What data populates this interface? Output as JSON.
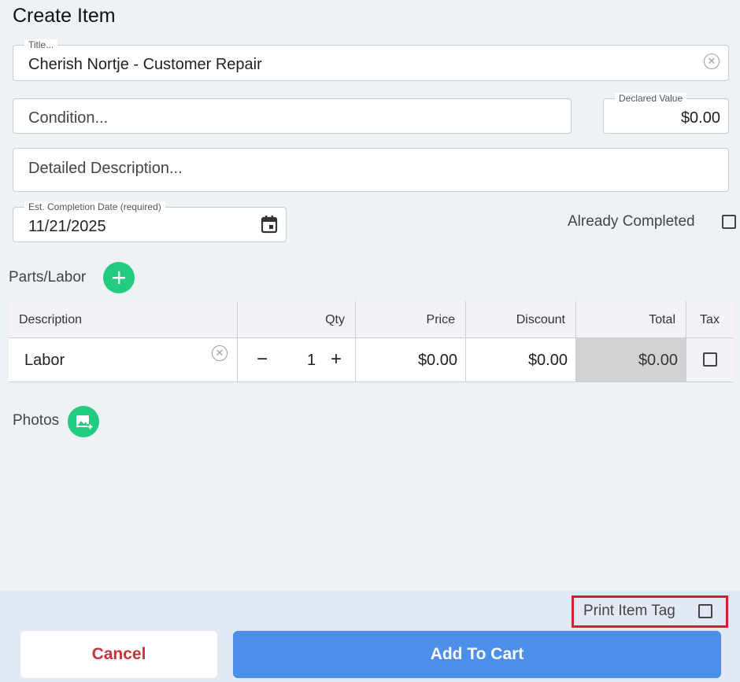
{
  "page": {
    "title": "Create Item"
  },
  "title_field": {
    "label": "Title...",
    "value": "Cherish Nortje - Customer Repair"
  },
  "condition_field": {
    "placeholder": "Condition..."
  },
  "declared_value": {
    "label": "Declared Value",
    "value": "$0.00"
  },
  "description_field": {
    "placeholder": "Detailed Description..."
  },
  "completion_date": {
    "label": "Est. Completion Date (required)",
    "value": "11/21/2025"
  },
  "already_completed": {
    "label": "Already Completed",
    "checked": false
  },
  "parts_labor": {
    "label": "Parts/Labor",
    "columns": {
      "description": "Description",
      "qty": "Qty",
      "price": "Price",
      "discount": "Discount",
      "total": "Total",
      "tax": "Tax"
    },
    "rows": [
      {
        "description": "Labor",
        "qty": "1",
        "price": "$0.00",
        "discount": "$0.00",
        "total": "$0.00",
        "tax": false
      }
    ]
  },
  "photos": {
    "label": "Photos"
  },
  "footer": {
    "print_item_tag": "Print Item Tag",
    "cancel": "Cancel",
    "add_to_cart": "Add To Cart"
  },
  "colors": {
    "accent_green": "#22cc7e",
    "primary_blue": "#4b8fea",
    "cancel_red": "#c8343a",
    "highlight_red": "#d42129"
  },
  "icons": [
    "clear-icon",
    "calendar-icon",
    "plus-icon",
    "minus-icon",
    "add-photo-icon"
  ]
}
